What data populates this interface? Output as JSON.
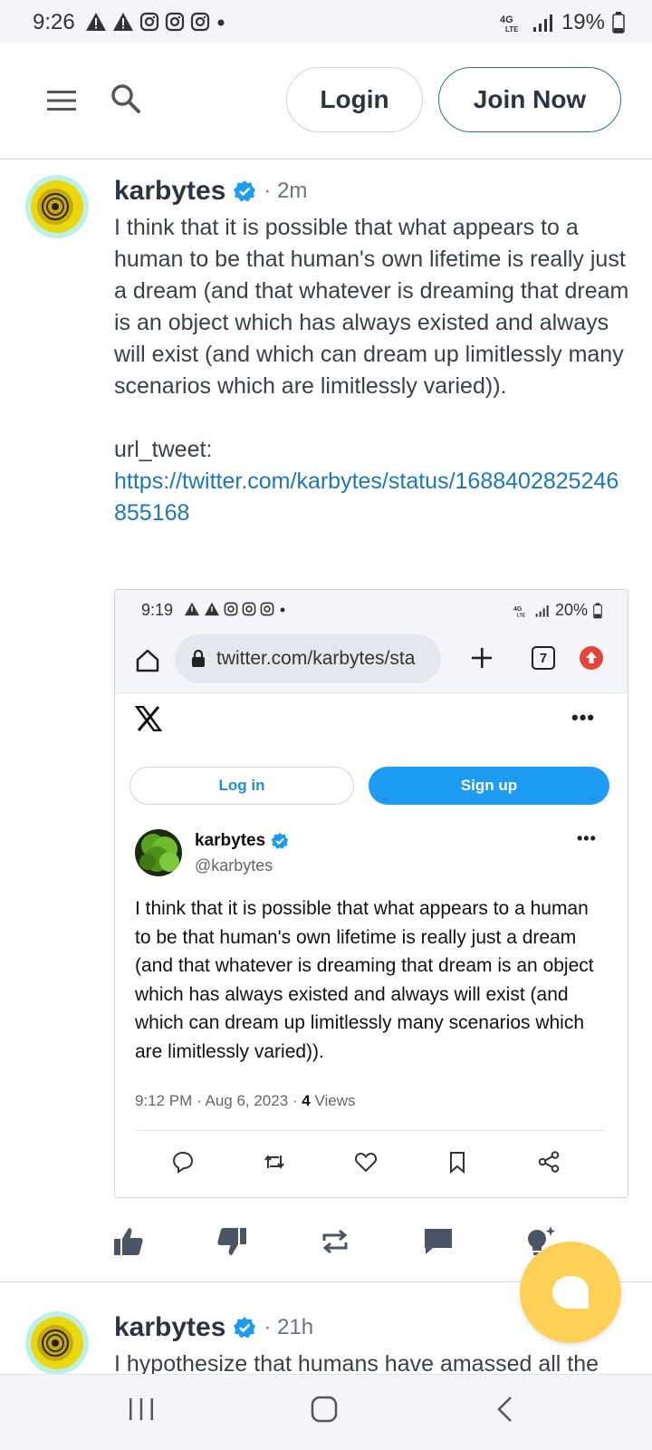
{
  "status_bar": {
    "time": "9:26",
    "battery": "19%",
    "network": "4G LTE"
  },
  "header": {
    "login_label": "Login",
    "join_label": "Join Now"
  },
  "posts": [
    {
      "author": "karbytes",
      "age": "· 2m",
      "text": "I think that it is possible that what appears to a human to be that human's own lifetime is really just a dream (and that whatever is dreaming that dream is an object which has always existed and always will exist (and which can dream up limitlessly many scenarios which are limitlessly varied)).",
      "url_label": "url_tweet:",
      "url": "https://twitter.com/karbytes/status/1688402825246855168"
    },
    {
      "author": "karbytes",
      "age": "· 21h",
      "text": "I hypothesize that humans have amassed all the"
    }
  ],
  "embed": {
    "status_time": "9:19",
    "battery": "20%",
    "url": "twitter.com/karbytes/sta",
    "tab_count": "7",
    "login_label": "Log in",
    "signup_label": "Sign up",
    "name": "karbytes",
    "handle": "@karbytes",
    "text": "I think that it is possible that what appears to a human to be that human's own lifetime is really just a dream (and that whatever is dreaming that dream is an object which has always existed and always will exist (and which can dream up limitlessly many scenarios which are limitlessly varied)).",
    "time": "9:12 PM · Aug 6, 2023 ·",
    "views_count": "4",
    "views_label": "Views"
  },
  "colors": {
    "link": "#1b78b8",
    "verified": "#1d9bf0",
    "fab": "#fdd155",
    "signup": "#1d9bf0"
  },
  "icons": [
    "menu-icon",
    "search-icon",
    "verified-icon",
    "like-icon",
    "dislike-icon",
    "repost-icon",
    "comment-icon",
    "idea-icon",
    "chat-icon"
  ]
}
